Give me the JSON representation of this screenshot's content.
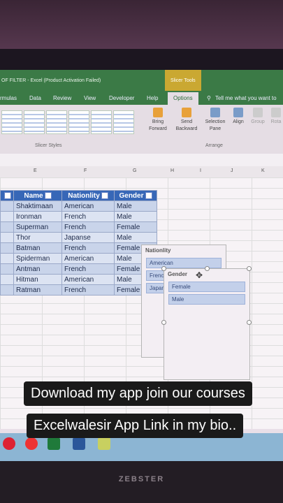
{
  "window": {
    "title": "OF FILTER - Excel (Product Activation Failed)",
    "context_tab": "Slicer Tools"
  },
  "tabs": [
    {
      "label": "rmulas"
    },
    {
      "label": "Data"
    },
    {
      "label": "Review"
    },
    {
      "label": "View"
    },
    {
      "label": "Developer"
    },
    {
      "label": "Help"
    },
    {
      "label": "Options"
    },
    {
      "label": "Tell me what you want to"
    }
  ],
  "ribbon": {
    "slicer_styles_label": "Slicer Styles",
    "arrange_label": "Arrange",
    "bring_forward": "Bring Forward",
    "send_backward": "Send Backward",
    "selection_pane": "Selection Pane",
    "align": "Align",
    "group": "Group",
    "rotate": "Rota"
  },
  "columns": [
    "E",
    "F",
    "G",
    "H",
    "I",
    "J",
    "K"
  ],
  "table": {
    "headers": [
      "Name",
      "Nationlity",
      "Gender"
    ],
    "rows": [
      [
        "Shaktimaan",
        "American",
        "Male"
      ],
      [
        "Ironman",
        "French",
        "Male"
      ],
      [
        "Superman",
        "French",
        "Female"
      ],
      [
        "Thor",
        "Japanse",
        "Male"
      ],
      [
        "Batman",
        "French",
        "Female"
      ],
      [
        "Spiderman",
        "American",
        "Male"
      ],
      [
        "Antman",
        "French",
        "Female"
      ],
      [
        "Hitman",
        "American",
        "Male"
      ],
      [
        "Ratman",
        "French",
        "Female"
      ]
    ]
  },
  "slicer_nationality": {
    "title": "Nationlity",
    "items": [
      "American",
      "Frenc",
      "Japan"
    ]
  },
  "slicer_gender": {
    "title": "Gender",
    "items": [
      "Female",
      "Male"
    ]
  },
  "captions": {
    "line1": "Download my app join our courses",
    "line2": "Excelwalesir App Link in my bio.."
  },
  "monitor_brand": "ZEBSTER"
}
